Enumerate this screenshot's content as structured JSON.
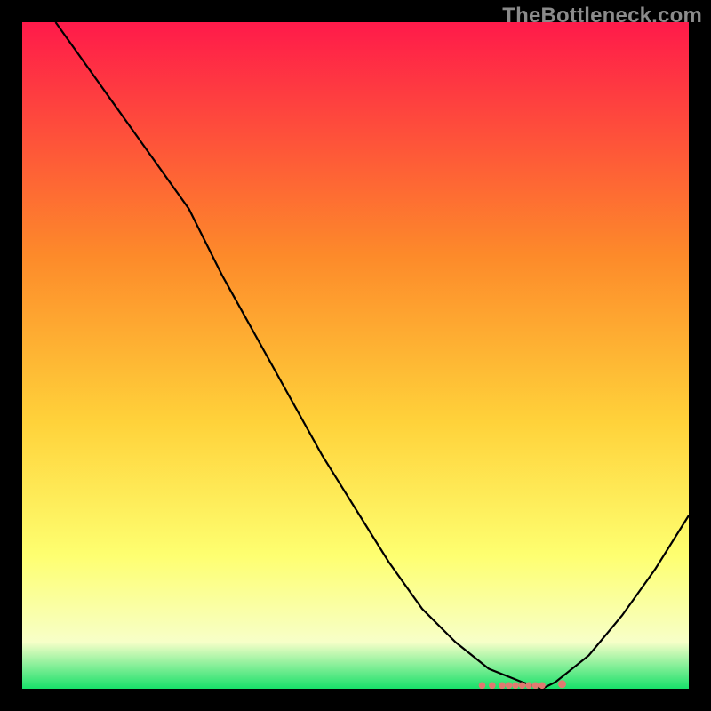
{
  "watermark": "TheBottleneck.com",
  "colors": {
    "background": "#000000",
    "gradient_top": "#ff1a4a",
    "gradient_upper_mid": "#fd8a2a",
    "gradient_mid": "#ffd23a",
    "gradient_lower_mid": "#feff70",
    "gradient_pale": "#f7ffc8",
    "gradient_bottom": "#18e06a",
    "curve": "#000000",
    "markers": "#e07a70"
  },
  "chart_data": {
    "type": "line",
    "title": "",
    "xlabel": "",
    "ylabel": "",
    "xlim": [
      0,
      100
    ],
    "ylim": [
      0,
      100
    ],
    "series": [
      {
        "name": "bottleneck-curve",
        "x": [
          5,
          10,
          15,
          20,
          25,
          30,
          35,
          40,
          45,
          50,
          55,
          60,
          65,
          70,
          75,
          78,
          80,
          85,
          90,
          95,
          100
        ],
        "y": [
          100,
          93,
          86,
          79,
          72,
          62,
          53,
          44,
          35,
          27,
          19,
          12,
          7,
          3,
          1,
          0,
          1,
          5,
          11,
          18,
          26
        ]
      }
    ],
    "markers": {
      "name": "optimum-cluster",
      "x": [
        69,
        70.5,
        72,
        73,
        74,
        75,
        76,
        77,
        78,
        81
      ],
      "y": [
        0.5,
        0.5,
        0.5,
        0.5,
        0.5,
        0.5,
        0.5,
        0.5,
        0.5,
        0.7
      ]
    }
  }
}
